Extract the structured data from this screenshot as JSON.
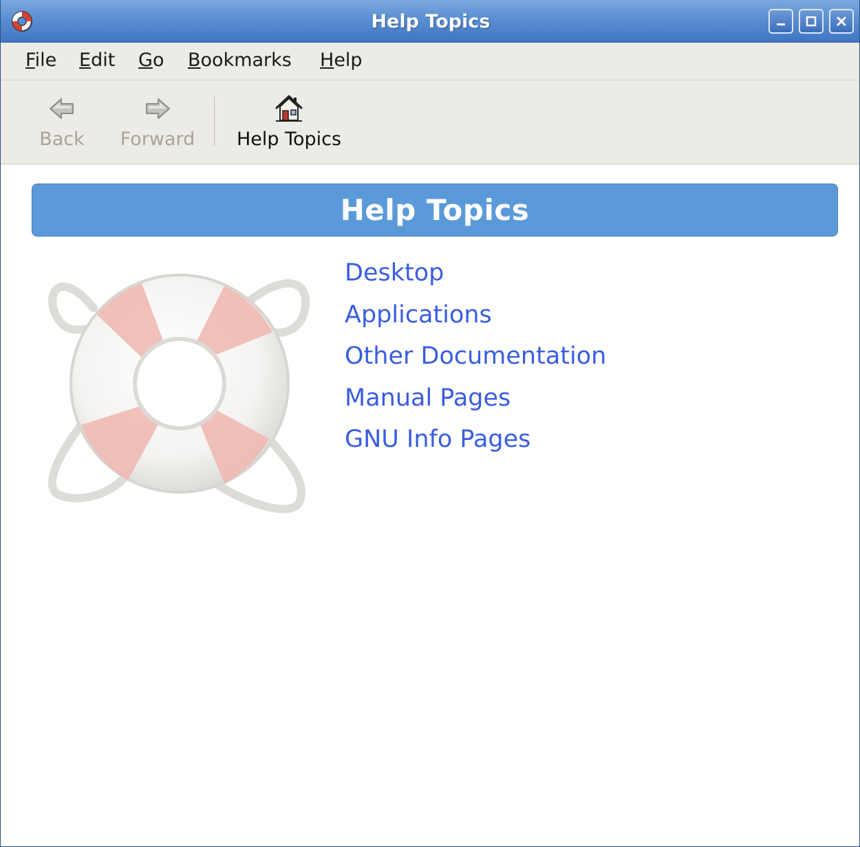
{
  "window": {
    "title": "Help Topics",
    "icon": "lifebuoy-icon",
    "controls": [
      "minimize-icon",
      "maximize-icon",
      "close-icon"
    ]
  },
  "menubar": {
    "items": [
      {
        "accel": "F",
        "rest": "ile"
      },
      {
        "accel": "E",
        "rest": "dit"
      },
      {
        "accel": "G",
        "rest": "o"
      },
      {
        "accel": "B",
        "rest": "ookmarks"
      },
      {
        "accel": "H",
        "rest": "elp"
      }
    ]
  },
  "toolbar": {
    "back": {
      "label": "Back",
      "icon": "back-arrow-icon",
      "enabled": false
    },
    "forward": {
      "label": "Forward",
      "icon": "forward-arrow-icon",
      "enabled": false
    },
    "home": {
      "label": "Help Topics",
      "icon": "home-icon",
      "enabled": true
    }
  },
  "content": {
    "banner_title": "Help Topics",
    "topics": [
      "Desktop",
      "Applications",
      "Other Documentation",
      "Manual Pages",
      "GNU Info Pages"
    ]
  },
  "colors": {
    "titlebar": "#5b8fd2",
    "banner": "#5b9ad9",
    "link": "#3a5de0",
    "chrome": "#edebe6"
  }
}
